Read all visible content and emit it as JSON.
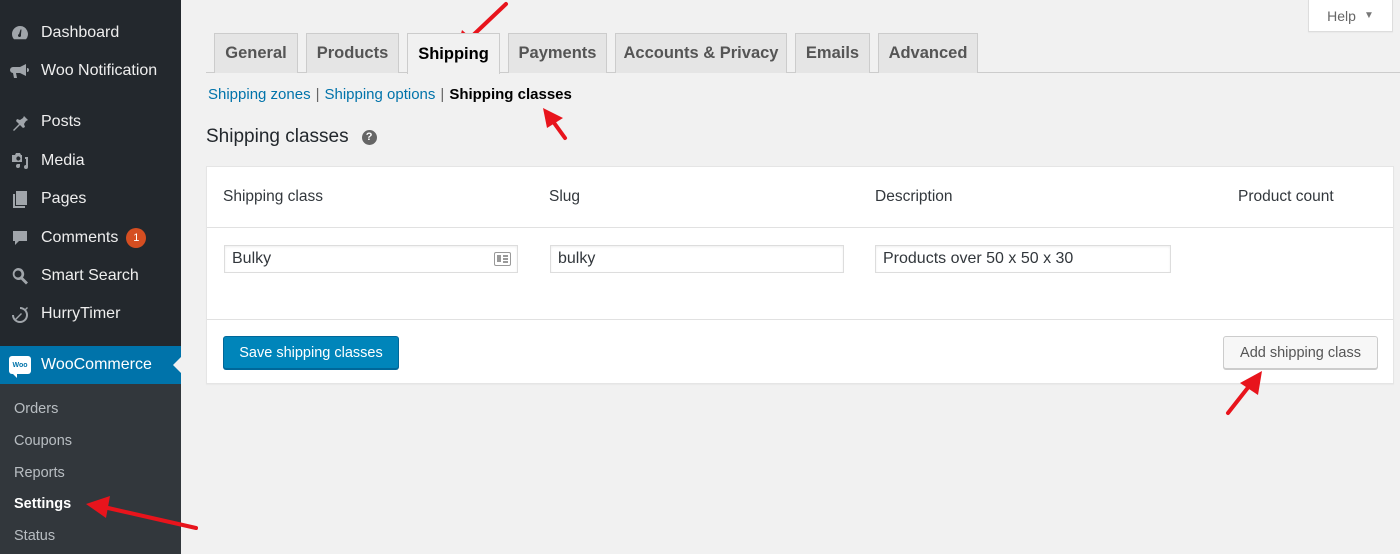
{
  "sidebar": {
    "items": [
      {
        "label": "Dashboard",
        "icon": "dashboard-icon"
      },
      {
        "label": "Woo Notification",
        "icon": "megaphone-icon"
      },
      {
        "label": "Posts",
        "icon": "pin-icon"
      },
      {
        "label": "Media",
        "icon": "media-icon"
      },
      {
        "label": "Pages",
        "icon": "pages-icon"
      },
      {
        "label": "Comments",
        "icon": "comment-icon",
        "badge": "1"
      },
      {
        "label": "Smart Search",
        "icon": "search-icon"
      },
      {
        "label": "HurryTimer",
        "icon": "timer-icon"
      }
    ],
    "active": {
      "label": "WooCommerce",
      "logo_text": "Woo"
    },
    "submenu": [
      {
        "label": "Orders"
      },
      {
        "label": "Coupons"
      },
      {
        "label": "Reports"
      },
      {
        "label": "Settings",
        "current": true
      },
      {
        "label": "Status"
      }
    ]
  },
  "help": {
    "label": "Help",
    "caret": "▼"
  },
  "tabs": [
    {
      "label": "General"
    },
    {
      "label": "Products"
    },
    {
      "label": "Shipping",
      "active": true
    },
    {
      "label": "Payments"
    },
    {
      "label": "Accounts & Privacy"
    },
    {
      "label": "Emails"
    },
    {
      "label": "Advanced"
    }
  ],
  "subnav": {
    "links": [
      "Shipping zones",
      "Shipping options"
    ],
    "current": "Shipping classes",
    "separator": "|"
  },
  "section": {
    "title": "Shipping classes",
    "help_tip": "?"
  },
  "table": {
    "columns": [
      "Shipping class",
      "Slug",
      "Description",
      "Product count"
    ],
    "rows": [
      {
        "shipping_class": "Bulky",
        "slug": "bulky",
        "description": "Products over 50 x 50 x 30",
        "product_count": ""
      }
    ],
    "save_label": "Save shipping classes",
    "add_label": "Add shipping class"
  },
  "colors": {
    "accent": "#0073aa",
    "button_primary": "#0085ba",
    "sidebar_bg": "#23282d",
    "badge": "#d54e21",
    "annotation_arrow": "#e8141c"
  }
}
